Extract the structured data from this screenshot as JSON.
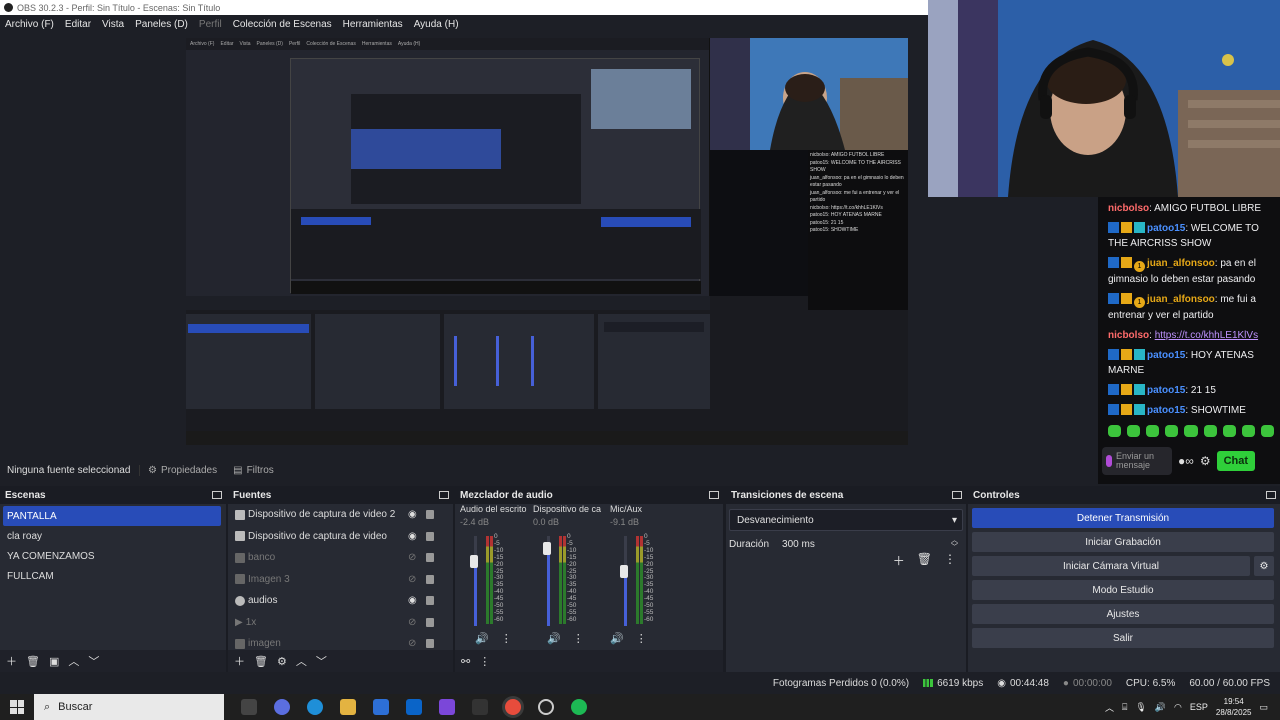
{
  "window_title": "OBS 30.2.3 - Perfil: Sin Título - Escenas: Sin Título",
  "menu": [
    "Archivo (F)",
    "Editar",
    "Vista",
    "Paneles (D)",
    "Perfil",
    "Colección de Escenas",
    "Herramientas",
    "Ayuda (H)"
  ],
  "chat": {
    "messages": [
      {
        "user": "nicbolso",
        "color": "red",
        "badges": [],
        "text": ": AMIGO FUTBOL LIBRE"
      },
      {
        "user": "patoo15",
        "color": "blue",
        "badges": [
          "blue",
          "gold",
          "cyan"
        ],
        "text": ": WELCOME TO THE AIRCRISS SHOW"
      },
      {
        "user": "juan_alfonsoo",
        "color": "gold",
        "badges": [
          "blue",
          "gold",
          "coin"
        ],
        "text": ": pa en el gimnasio lo deben estar pasando"
      },
      {
        "user": "juan_alfonsoo",
        "color": "gold",
        "badges": [
          "blue",
          "gold",
          "coin"
        ],
        "text": ": me fui a entrenar y ver el partido"
      },
      {
        "user": "nicbolso",
        "color": "red",
        "badges": [],
        "text": ": ",
        "link": "https://t.co/khhLE1KlVs"
      },
      {
        "user": "patoo15",
        "color": "blue",
        "badges": [
          "blue",
          "gold",
          "cyan"
        ],
        "text": ": HOY ATENAS MARNE"
      },
      {
        "user": "patoo15",
        "color": "blue",
        "badges": [
          "blue",
          "gold",
          "cyan"
        ],
        "text": ": 21 15"
      },
      {
        "user": "patoo15",
        "color": "blue",
        "badges": [
          "blue",
          "gold",
          "cyan"
        ],
        "text": ": SHOWTIME"
      }
    ],
    "input_placeholder": "Enviar un mensaje",
    "send_label": "Chat"
  },
  "source_bar": {
    "no_source": "Ninguna fuente seleccionad",
    "properties": "Propiedades",
    "filters": "Filtros"
  },
  "scenes": {
    "title": "Escenas",
    "items": [
      "PANTALLA",
      "cla roay",
      "YA COMENZAMOS",
      "FULLCAM"
    ],
    "active": 0
  },
  "sources": {
    "title": "Fuentes",
    "items": [
      {
        "name": "Dispositivo de captura de video 2",
        "visible": true
      },
      {
        "name": "Dispositivo de captura de video",
        "visible": true
      },
      {
        "name": "banco",
        "visible": false
      },
      {
        "name": "Imagen 3",
        "visible": false
      },
      {
        "name": "audios",
        "visible": true
      },
      {
        "name": "1x",
        "visible": false
      },
      {
        "name": "imagen",
        "visible": false
      }
    ]
  },
  "mixer": {
    "title": "Mezclador de audio",
    "channels": [
      {
        "name": "Audio del escrito",
        "db": "-2.4 dB",
        "level": 0.72
      },
      {
        "name": "Dispositivo de ca",
        "db": "0.0 dB",
        "level": 0.86
      },
      {
        "name": "Mic/Aux",
        "db": "-9.1 dB",
        "level": 0.6
      }
    ],
    "scale": [
      "0",
      "-5",
      "-10",
      "-15",
      "-20",
      "-25",
      "-30",
      "-35",
      "-40",
      "-45",
      "-50",
      "-55",
      "-60"
    ]
  },
  "transitions": {
    "title": "Transiciones de escena",
    "selected": "Desvanecimiento",
    "duration_label": "Duración",
    "duration_value": "300 ms"
  },
  "controls": {
    "title": "Controles",
    "buttons": [
      "Detener Transmisión",
      "Iniciar Grabación",
      "Iniciar Cámara Virtual",
      "Modo Estudio",
      "Ajustes",
      "Salir"
    ]
  },
  "status": {
    "dropped": "Fotogramas Perdidos 0 (0.0%)",
    "bitrate": "6619 kbps",
    "stream_time": "00:44:48",
    "rec_time": "00:00:00",
    "cpu": "CPU: 6.5%",
    "fps": "60.00 / 60.00 FPS"
  },
  "taskbar": {
    "search": "Buscar",
    "lang": "ESP",
    "time": "19:54",
    "date": "28/8/2025"
  },
  "preview_mini": {
    "menu": [
      "Archivo (F)",
      "Editar",
      "Vista",
      "Paneles (D)",
      "Perfil",
      "Colección de Escenas",
      "Herramientas",
      "Ayuda (H)"
    ],
    "chat": [
      "nicbolso: AMIGO FUTBOL LIBRE",
      "patoo15: WELCOME TO THE AIRCRISS SHOW",
      "juan_alfonsoo: pa en el gimnasio lo deben estar pasando",
      "juan_alfonsoo: me fui a entrenar y ver el partido",
      "nicbolso: https://t.co/khhLE1KlVs",
      "patoo15: HOY ATENAS MARNE",
      "patoo15: 21 15",
      "patoo15: SHOWTIME"
    ]
  }
}
